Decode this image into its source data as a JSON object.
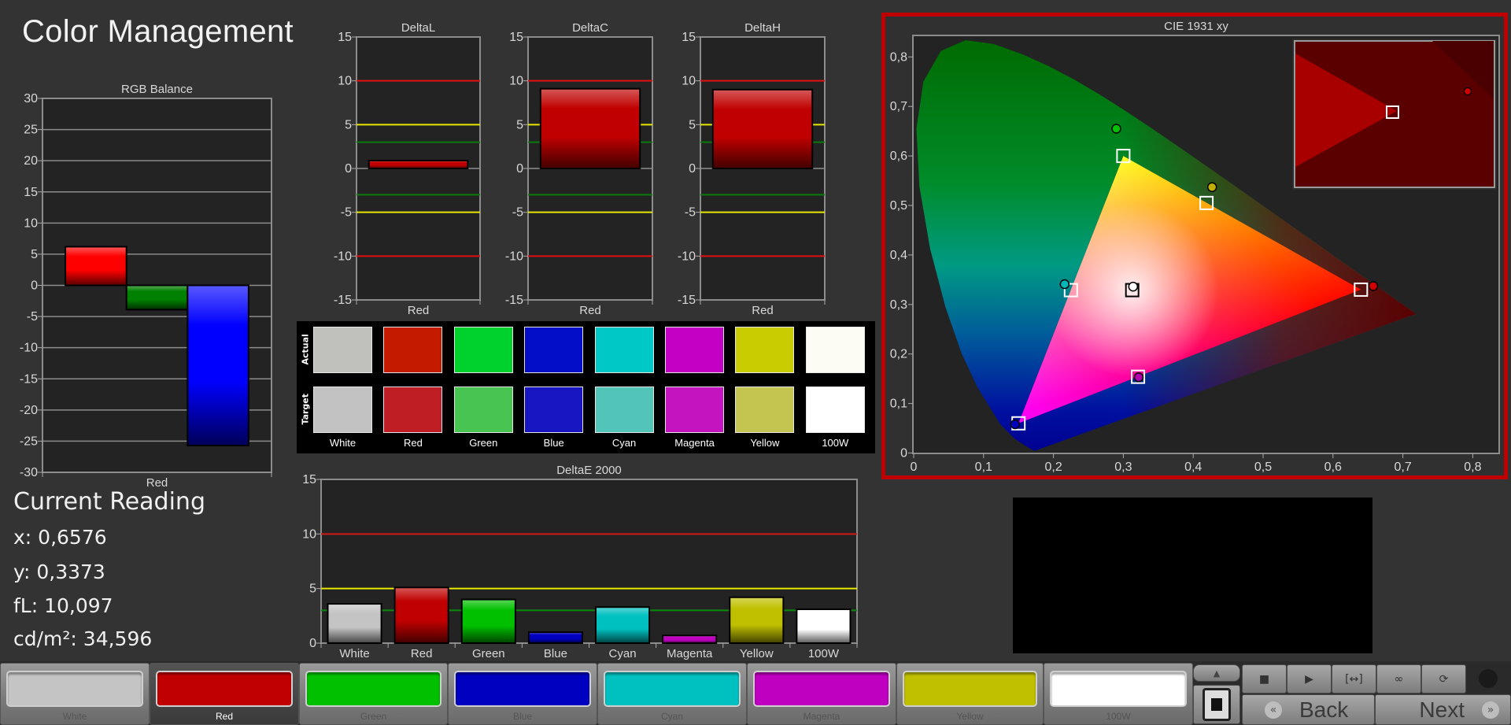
{
  "app": {
    "title": "Color Management"
  },
  "current_reading": {
    "heading": "Current Reading",
    "x": "x: 0,6576",
    "y": "y: 0,3373",
    "fl": "fL: 10,097",
    "cdm2": "cd/m²: 34,596"
  },
  "swatches": {
    "actual_label": "Actual",
    "target_label": "Target",
    "items": [
      {
        "name": "White",
        "actual": "#c0c1bd",
        "target": "#c2c2c2"
      },
      {
        "name": "Red",
        "actual": "#c41a00",
        "target": "#be1e24"
      },
      {
        "name": "Green",
        "actual": "#00d22d",
        "target": "#48c452"
      },
      {
        "name": "Blue",
        "actual": "#020fc6",
        "target": "#1816c0"
      },
      {
        "name": "Cyan",
        "actual": "#00c8c6",
        "target": "#52c4b8"
      },
      {
        "name": "Magenta",
        "actual": "#c400c4",
        "target": "#c414c0"
      },
      {
        "name": "Yellow",
        "actual": "#c8cc00",
        "target": "#c4c450"
      },
      {
        "name": "100W",
        "actual": "#fcfcf4",
        "target": "#ffffff"
      }
    ]
  },
  "chart_data": [
    {
      "id": "rgb",
      "type": "bar",
      "title": "RGB Balance",
      "categories": [
        "Red"
      ],
      "bars": [
        {
          "value": 6.2,
          "color": "#ff0000"
        },
        {
          "value": -3.9,
          "color": "#008000"
        },
        {
          "value": -25.7,
          "color": "#0000ff"
        }
      ],
      "ylim": [
        -30,
        30
      ],
      "yticks": [
        30,
        25,
        20,
        15,
        10,
        5,
        0,
        -5,
        -10,
        -15,
        -20,
        -25,
        -30
      ],
      "grid": true,
      "ref_lines": []
    },
    {
      "id": "deltaL",
      "type": "bar",
      "title": "DeltaL",
      "categories": [
        "Red"
      ],
      "bars": [
        {
          "value": 0.9,
          "color": "#c00000"
        }
      ],
      "ylim": [
        -15,
        15
      ],
      "yticks": [
        15,
        10,
        5,
        0,
        -5,
        -10,
        -15
      ],
      "grid": false,
      "ref_lines": [
        {
          "value": 10,
          "color": "#e01010"
        },
        {
          "value": -10,
          "color": "#e01010"
        },
        {
          "value": 5,
          "color": "#e8e800"
        },
        {
          "value": -5,
          "color": "#e8e800"
        },
        {
          "value": 3,
          "color": "#0a7a0a"
        },
        {
          "value": -3,
          "color": "#0a7a0a"
        }
      ]
    },
    {
      "id": "deltaC",
      "type": "bar",
      "title": "DeltaC",
      "categories": [
        "Red"
      ],
      "bars": [
        {
          "value": 9.1,
          "color": "#c00000"
        }
      ],
      "ylim": [
        -15,
        15
      ],
      "yticks": [
        15,
        10,
        5,
        0,
        -5,
        -10,
        -15
      ],
      "grid": false,
      "ref_lines": [
        {
          "value": 10,
          "color": "#e01010"
        },
        {
          "value": -10,
          "color": "#e01010"
        },
        {
          "value": 5,
          "color": "#e8e800"
        },
        {
          "value": -5,
          "color": "#e8e800"
        },
        {
          "value": 3,
          "color": "#0a7a0a"
        },
        {
          "value": -3,
          "color": "#0a7a0a"
        }
      ]
    },
    {
      "id": "deltaH",
      "type": "bar",
      "title": "DeltaH",
      "categories": [
        "Red"
      ],
      "bars": [
        {
          "value": 9.0,
          "color": "#c00000"
        }
      ],
      "ylim": [
        -15,
        15
      ],
      "yticks": [
        15,
        10,
        5,
        0,
        -5,
        -10,
        -15
      ],
      "grid": false,
      "ref_lines": [
        {
          "value": 10,
          "color": "#e01010"
        },
        {
          "value": -10,
          "color": "#e01010"
        },
        {
          "value": 5,
          "color": "#e8e800"
        },
        {
          "value": -5,
          "color": "#e8e800"
        },
        {
          "value": 3,
          "color": "#0a7a0a"
        },
        {
          "value": -3,
          "color": "#0a7a0a"
        }
      ]
    },
    {
      "id": "deltaE",
      "type": "bar",
      "title": "DeltaE 2000",
      "categories": [
        "White",
        "Red",
        "Green",
        "Blue",
        "Cyan",
        "Magenta",
        "Yellow",
        "100W"
      ],
      "values": [
        3.6,
        5.1,
        4.0,
        1.0,
        3.3,
        0.7,
        4.2,
        3.1
      ],
      "colors": [
        "#c4c4c4",
        "#c00000",
        "#00c000",
        "#0000c0",
        "#00c0c0",
        "#c000c0",
        "#c0c000",
        "#ffffff"
      ],
      "ylim": [
        0,
        15
      ],
      "yticks": [
        15,
        10,
        5,
        0
      ],
      "grid": false,
      "ref_lines": [
        {
          "value": 10,
          "color": "#d01818"
        },
        {
          "value": 5,
          "color": "#e8e800"
        },
        {
          "value": 3,
          "color": "#0a8a0a"
        }
      ]
    },
    {
      "id": "cie",
      "type": "scatter",
      "title": "CIE 1931 xy",
      "xlim": [
        0,
        0.84
      ],
      "ylim": [
        0,
        0.84
      ],
      "xticks": [
        "0",
        "0,1",
        "0,2",
        "0,3",
        "0,4",
        "0,5",
        "0,6",
        "0,7",
        "0,8"
      ],
      "yticks": [
        "0",
        "0,1",
        "0,2",
        "0,3",
        "0,4",
        "0,5",
        "0,6",
        "0,7",
        "0,8"
      ],
      "target_gamut": {
        "R": [
          0.64,
          0.33
        ],
        "G": [
          0.3,
          0.6
        ],
        "B": [
          0.15,
          0.06
        ],
        "W": [
          0.3127,
          0.329
        ]
      },
      "targets": [
        {
          "name": "White",
          "x": 0.3127,
          "y": 0.329
        },
        {
          "name": "Red",
          "x": 0.64,
          "y": 0.33
        },
        {
          "name": "Green",
          "x": 0.3,
          "y": 0.6
        },
        {
          "name": "Blue",
          "x": 0.15,
          "y": 0.06
        },
        {
          "name": "Cyan",
          "x": 0.225,
          "y": 0.329
        },
        {
          "name": "Magenta",
          "x": 0.321,
          "y": 0.154
        },
        {
          "name": "Yellow",
          "x": 0.419,
          "y": 0.505
        }
      ],
      "actuals": [
        {
          "name": "White",
          "x": 0.314,
          "y": 0.336,
          "color": "#ffffff"
        },
        {
          "name": "Red",
          "x": 0.6576,
          "y": 0.3373,
          "color": "#d00000"
        },
        {
          "name": "Green",
          "x": 0.29,
          "y": 0.655,
          "color": "#00c000"
        },
        {
          "name": "Blue",
          "x": 0.145,
          "y": 0.058,
          "color": "#0000c0"
        },
        {
          "name": "Cyan",
          "x": 0.216,
          "y": 0.341,
          "color": "#00b8b8"
        },
        {
          "name": "Magenta",
          "x": 0.322,
          "y": 0.153,
          "color": "#b000b0"
        },
        {
          "name": "Yellow",
          "x": 0.427,
          "y": 0.537,
          "color": "#c0b000"
        }
      ],
      "highlight_color": "#c00000"
    }
  ],
  "patch_buttons": [
    {
      "label": "White",
      "color": "#c4c4c4",
      "selected": false
    },
    {
      "label": "Red",
      "color": "#c00000",
      "selected": true
    },
    {
      "label": "Green",
      "color": "#00c000",
      "selected": false
    },
    {
      "label": "Blue",
      "color": "#0000c0",
      "selected": false
    },
    {
      "label": "Cyan",
      "color": "#00c0c0",
      "selected": false
    },
    {
      "label": "Magenta",
      "color": "#c000c0",
      "selected": false
    },
    {
      "label": "Yellow",
      "color": "#c0c000",
      "selected": false
    },
    {
      "label": "100W",
      "color": "#ffffff",
      "selected": false
    }
  ],
  "controls": {
    "up_icon": "▲",
    "stop_icon": "stop-square",
    "transport": [
      {
        "name": "stop",
        "glyph": "■"
      },
      {
        "name": "play",
        "glyph": "▶"
      },
      {
        "name": "step",
        "glyph": "[↔]"
      },
      {
        "name": "loop",
        "glyph": "∞"
      },
      {
        "name": "refresh",
        "glyph": "⟳"
      }
    ],
    "back_label": "Back",
    "next_label": "Next",
    "back_glyph": "«",
    "next_glyph": "»"
  }
}
